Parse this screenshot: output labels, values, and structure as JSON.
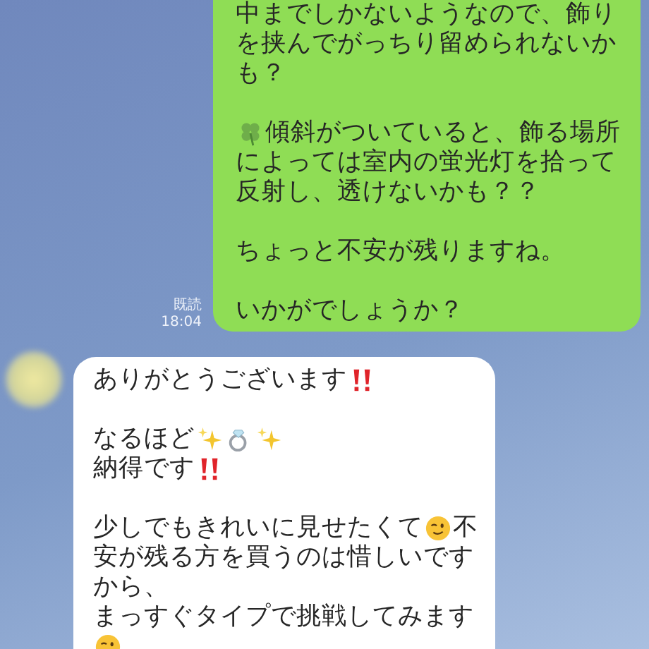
{
  "messages": [
    {
      "kind": "sent",
      "read_label": "既読",
      "time": "18:04",
      "paragraphs": [
        [
          [
            {
              "kind": "text",
              "text": "中までしかないようなので、飾り"
            }
          ],
          [
            {
              "kind": "text",
              "text": "を挟んでがっちり留められないか"
            }
          ],
          [
            {
              "kind": "text",
              "text": "も？"
            }
          ]
        ],
        [
          [
            {
              "kind": "clover"
            },
            {
              "kind": "text",
              "text": "傾斜がついていると、飾る場所"
            }
          ],
          [
            {
              "kind": "text",
              "text": "によっては室内の蛍光灯を拾って"
            }
          ],
          [
            {
              "kind": "text",
              "text": "反射し、透けないかも？？"
            }
          ]
        ],
        [
          [
            {
              "kind": "text",
              "text": "ちょっと不安が残りますね。"
            }
          ]
        ],
        [
          [
            {
              "kind": "text",
              "text": "いかがでしょうか？"
            }
          ]
        ]
      ]
    },
    {
      "kind": "received",
      "paragraphs": [
        [
          [
            {
              "kind": "text",
              "text": "ありがとうございます"
            },
            {
              "kind": "double-exclamation"
            }
          ]
        ],
        [
          [
            {
              "kind": "text",
              "text": "なるほど"
            },
            {
              "kind": "sparkles"
            },
            {
              "kind": "ring"
            },
            {
              "kind": "sparkles"
            }
          ],
          [
            {
              "kind": "text",
              "text": "納得です"
            },
            {
              "kind": "double-exclamation"
            }
          ]
        ],
        [
          [
            {
              "kind": "text",
              "text": "少しでもきれいに見せたくて"
            },
            {
              "kind": "wink"
            },
            {
              "kind": "text",
              "text": "不"
            }
          ],
          [
            {
              "kind": "text",
              "text": "安が残る方を買うのは惜しいです"
            }
          ],
          [
            {
              "kind": "text",
              "text": "から、"
            }
          ],
          [
            {
              "kind": "text",
              "text": "まっすぐタイプで挑戦してみます"
            }
          ],
          [
            {
              "kind": "wink"
            }
          ]
        ]
      ]
    }
  ]
}
